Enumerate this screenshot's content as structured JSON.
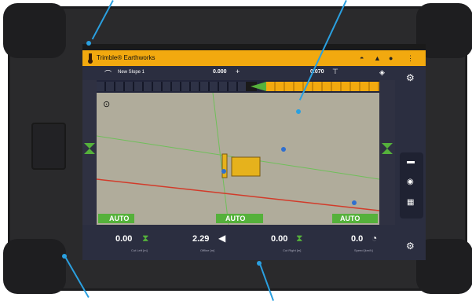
{
  "app": {
    "title": "Trimble® Earthworks"
  },
  "toolbar": {
    "design_name": "New Slope 1",
    "value_center": "0.000",
    "value_right": "0.070"
  },
  "bottom": {
    "cut_left": {
      "value": "0.00",
      "label": "Cut Left [m]"
    },
    "offline": {
      "value": "2.29",
      "label": "Offline [m]"
    },
    "cut_right": {
      "value": "0.00",
      "label": "Cut Right [m]"
    },
    "speed": {
      "value": "0.0",
      "label": "Speed [km/h]"
    }
  },
  "auto_buttons": {
    "left": "AUTO",
    "center": "AUTO",
    "right": "AUTO"
  },
  "colors": {
    "accent": "#f2a90f",
    "green": "#55b13b",
    "panel": "#2b2e40",
    "map": "#b0ac9b",
    "callout": "#2aa0e0"
  },
  "icons": [
    "trimble-logo-icon",
    "bell-icon",
    "user-icon",
    "menu-icon",
    "settings-icon",
    "layers-icon",
    "map-icon"
  ]
}
